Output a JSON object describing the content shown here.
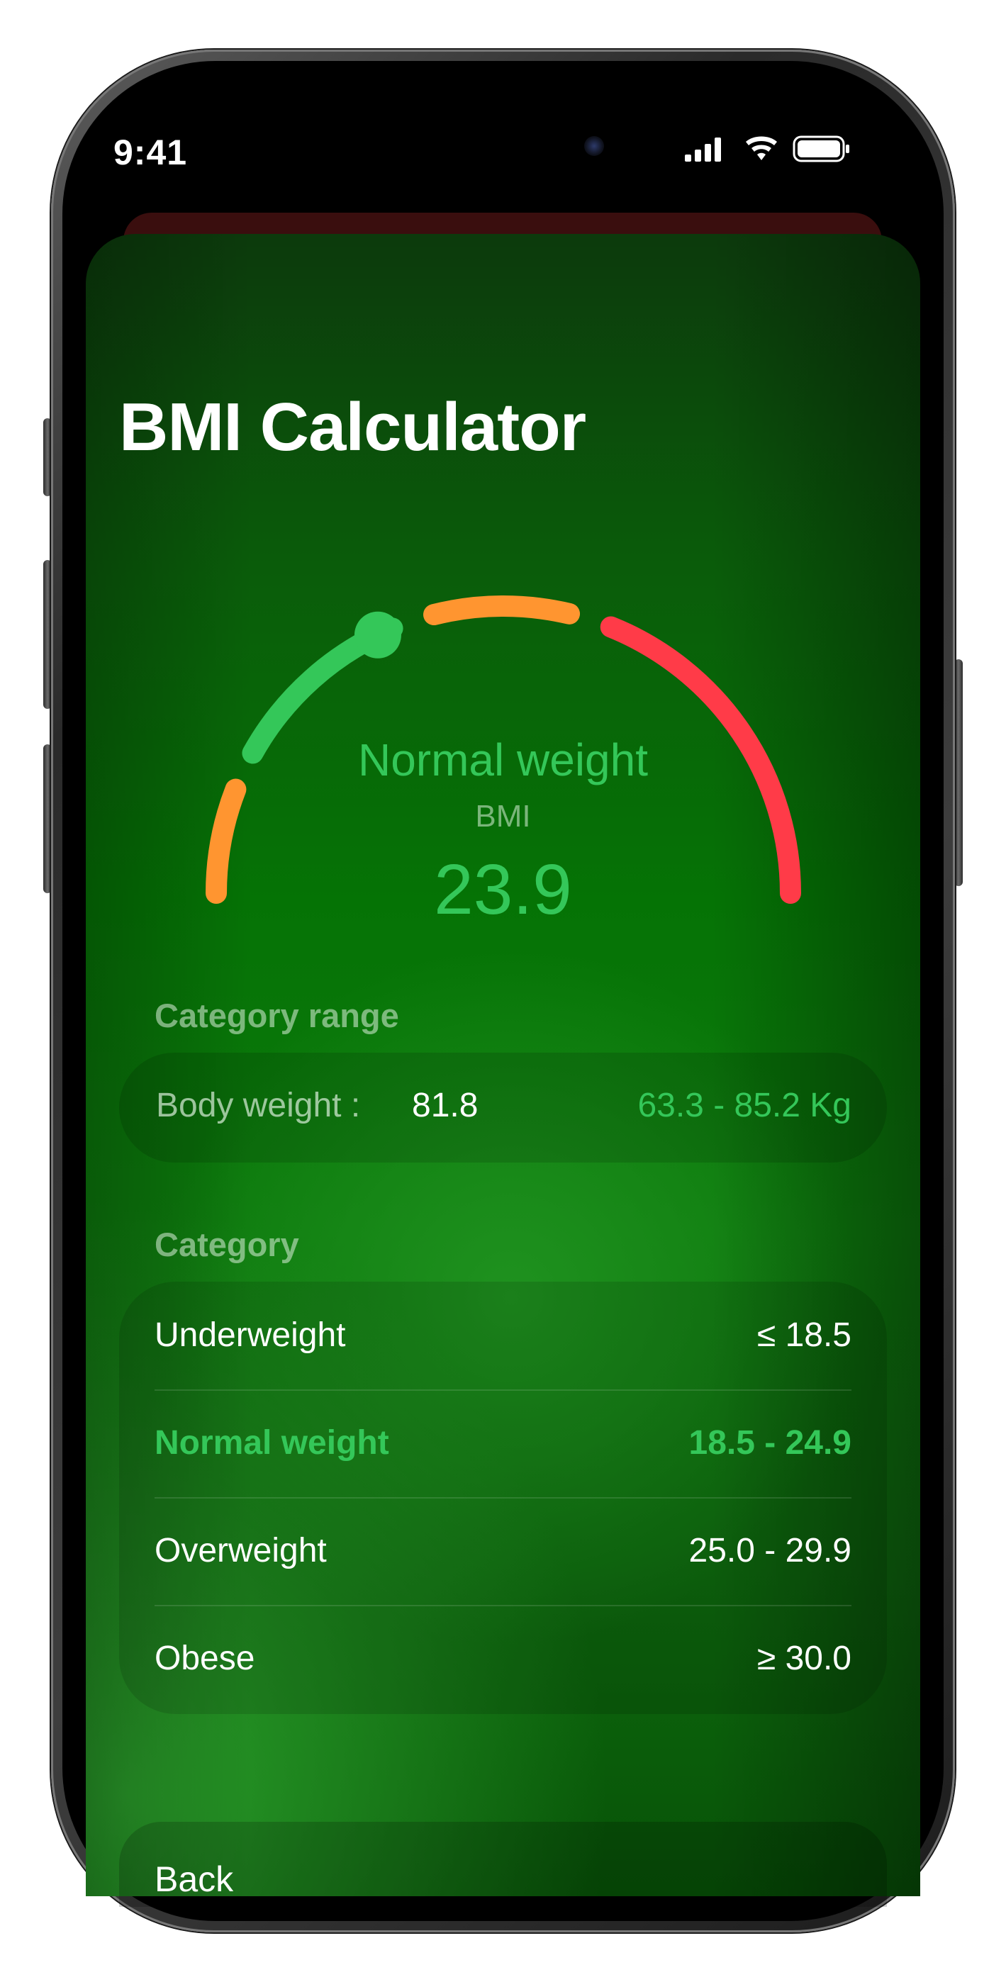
{
  "status_bar": {
    "time": "9:41"
  },
  "app": {
    "title": "BMI Calculator"
  },
  "gauge": {
    "category": "Normal weight",
    "label": "BMI",
    "value": "23.9",
    "bmi_numeric": 23.9,
    "scale_min": 15,
    "scale_max": 40,
    "segments": [
      {
        "name": "Underweight",
        "from": 15,
        "to": 18.5,
        "color": "#ff9530"
      },
      {
        "name": "Normal weight",
        "from": 18.5,
        "to": 24.9,
        "color": "#34c759"
      },
      {
        "name": "Overweight",
        "from": 25.0,
        "to": 29.9,
        "color": "#ff9530"
      },
      {
        "name": "Obese",
        "from": 30.0,
        "to": 40,
        "color": "#ff3b48"
      }
    ]
  },
  "category_range": {
    "section_title": "Category range",
    "label": "Body weight :",
    "value": "81.8",
    "range": "63.3 - 85.2 Kg"
  },
  "categories": {
    "section_title": "Category",
    "items": [
      {
        "name": "Underweight",
        "range": "≤ 18.5"
      },
      {
        "name": "Normal weight",
        "range": "18.5 - 24.9"
      },
      {
        "name": "Overweight",
        "range": "25.0 - 29.9"
      },
      {
        "name": "Obese",
        "range": "≥ 30.0"
      }
    ],
    "active_index": 1
  },
  "footer": {
    "back_label": "Back"
  },
  "colors": {
    "accent": "#34c759",
    "warning": "#ff9530",
    "danger": "#ff3b48",
    "background": "#057305"
  }
}
